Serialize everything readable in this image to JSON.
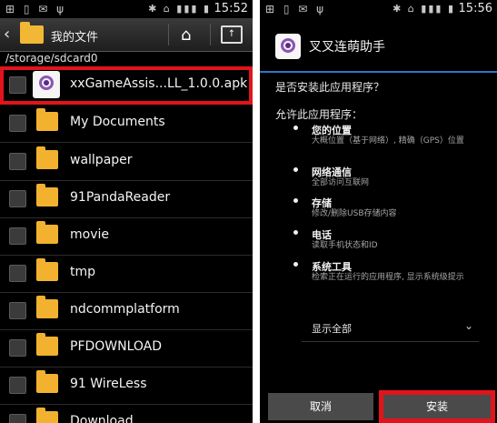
{
  "left_screen": {
    "status": {
      "time": "15:52"
    },
    "header": {
      "title": "我的文件"
    },
    "path": "/storage/sdcard0",
    "items": [
      {
        "label": "xxGameAssis...LL_1.0.0.apk"
      },
      {
        "label": "My Documents"
      },
      {
        "label": "wallpaper"
      },
      {
        "label": "91PandaReader"
      },
      {
        "label": "movie"
      },
      {
        "label": "tmp"
      },
      {
        "label": "ndcommplatform"
      },
      {
        "label": "PFDOWNLOAD"
      },
      {
        "label": "91 WireLess"
      },
      {
        "label": "Download"
      }
    ]
  },
  "right_screen": {
    "status": {
      "time": "15:56"
    },
    "app_title": "叉叉连萌助手",
    "question": "是否安装此应用程序？",
    "permissions_label": "允许此应用程序：",
    "permissions": [
      {
        "title": "您的位置",
        "desc": "大概位置（基于网络）, 精确（GPS）位置"
      },
      {
        "title": "网络通信",
        "desc": "全部访问互联网"
      },
      {
        "title": "存储",
        "desc": "修改/删除USB存储内容"
      },
      {
        "title": "电话",
        "desc": "读取手机状态和ID"
      },
      {
        "title": "系统工具",
        "desc": "检索正在运行的应用程序, 显示系统级提示"
      }
    ],
    "show_all_label": "显示全部",
    "buttons": {
      "cancel": "取消",
      "install": "安装"
    }
  },
  "colors": {
    "highlight": "#e2141b",
    "folder": "#f2b22f",
    "accent": "#2b76c8"
  }
}
